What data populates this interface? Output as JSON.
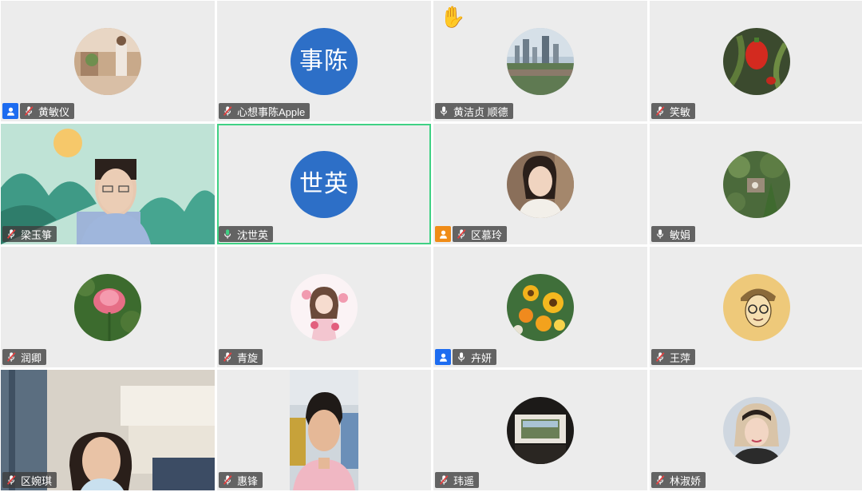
{
  "participants": [
    {
      "name": "黄敏仪",
      "badge": "user-blue",
      "mic": "muted"
    },
    {
      "name": "心想事陈Apple",
      "badge": "",
      "mic": "muted",
      "initials": "事陈"
    },
    {
      "name": "黄洁贞 顺德",
      "badge": "",
      "mic": "on",
      "raised_hand": "✋"
    },
    {
      "name": "笑敏",
      "badge": "",
      "mic": "muted"
    },
    {
      "name": "梁玉箏",
      "badge": "",
      "mic": "muted"
    },
    {
      "name": "沈世英",
      "badge": "",
      "mic": "speaking",
      "initials": "世英",
      "active_speaker": true
    },
    {
      "name": "区慕玲",
      "badge": "user-orange",
      "mic": "muted"
    },
    {
      "name": "敏娟",
      "badge": "",
      "mic": "on"
    },
    {
      "name": "润卿",
      "badge": "",
      "mic": "muted"
    },
    {
      "name": "青旋",
      "badge": "",
      "mic": "muted"
    },
    {
      "name": "卉妍",
      "badge": "user-blue",
      "mic": "on"
    },
    {
      "name": "王萍",
      "badge": "",
      "mic": "muted"
    },
    {
      "name": "区婉琪",
      "badge": "",
      "mic": "muted"
    },
    {
      "name": "惠锋",
      "badge": "",
      "mic": "muted"
    },
    {
      "name": "玮遥",
      "badge": "",
      "mic": "muted"
    },
    {
      "name": "林淑娇",
      "badge": "",
      "mic": "muted"
    }
  ],
  "colors": {
    "tile_bg": "#ececec",
    "initials_bg": "#2d6fc7",
    "speaking_border": "#3fd184",
    "speaking_mic": "#3fd184"
  }
}
